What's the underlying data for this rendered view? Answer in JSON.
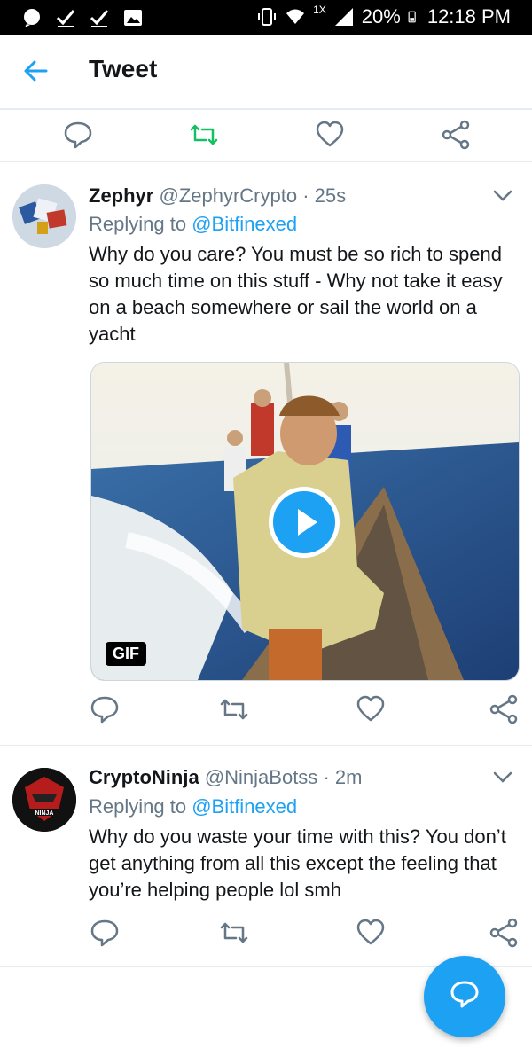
{
  "status_bar": {
    "battery": "20%",
    "time": "12:18 PM",
    "network": "1X"
  },
  "header": {
    "title": "Tweet"
  },
  "tweets": [
    {
      "name": "Zephyr",
      "handle": "@ZephyrCrypto",
      "time": "· 25s",
      "replying_prefix": "Replying to ",
      "replying_to": "@Bitfinexed",
      "text": "Why do you care? You must be so rich to spend so much time on this stuff - Why not take it easy on a beach somewhere or sail the world on a yacht",
      "media_badge": "GIF"
    },
    {
      "name": "CryptoNinja",
      "handle": "@NinjaBotss",
      "time": "· 2m",
      "replying_prefix": "Replying to ",
      "replying_to": "@Bitfinexed",
      "text": "Why do you waste your time with this? You don’t get anything from all this except the feeling that you’re helping people lol smh"
    }
  ],
  "colors": {
    "accent": "#1da1f2",
    "retweet_active": "#17bf63",
    "icon_gray": "#657786"
  }
}
